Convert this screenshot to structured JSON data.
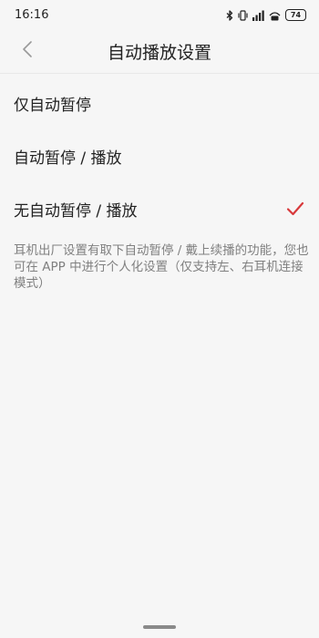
{
  "status_bar": {
    "time": "16:16",
    "battery": "74",
    "icons": [
      "bluetooth-icon",
      "vibrate-icon",
      "signal-icon",
      "hd-signal-icon"
    ]
  },
  "header": {
    "title": "自动播放设置",
    "back_icon": "chevron-left-icon"
  },
  "options": [
    {
      "label": "仅自动暂停",
      "selected": false
    },
    {
      "label": "自动暂停 / 播放",
      "selected": false
    },
    {
      "label": "无自动暂停 / 播放",
      "selected": true
    }
  ],
  "description": "耳机出厂设置有取下自动暂停 / 戴上续播的功能，您也可在 APP 中进行个人化设置（仅支持左、右耳机连接模式）",
  "colors": {
    "background": "#f6f6f6",
    "check_accent": "#d8393b",
    "secondary_text": "#808080"
  }
}
